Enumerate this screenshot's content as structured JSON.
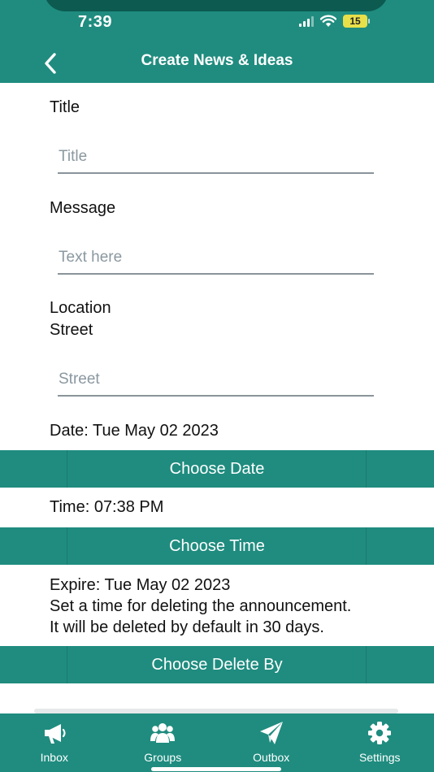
{
  "status": {
    "time": "7:39",
    "battery": "15"
  },
  "header": {
    "title": "Create News & Ideas"
  },
  "form": {
    "title_label": "Title",
    "title_placeholder": "Title",
    "message_label": "Message",
    "message_placeholder": "Text here",
    "location_label": "Location",
    "street_label": "Street",
    "street_placeholder": "Street"
  },
  "date": {
    "text": "Date: Tue May 02 2023",
    "button": "Choose Date"
  },
  "time": {
    "text": "Time: 07:38 PM",
    "button": "Choose Time"
  },
  "expire": {
    "line1": "Expire: Tue May 02 2023",
    "line2": "Set a time for deleting the announcement.",
    "line3": "It will be deleted by default in 30 days.",
    "button": "Choose Delete By"
  },
  "tabs": [
    {
      "label": "Inbox",
      "icon": "megaphone-icon"
    },
    {
      "label": "Groups",
      "icon": "group-icon"
    },
    {
      "label": "Outbox",
      "icon": "paper-plane-icon"
    },
    {
      "label": "Settings",
      "icon": "gear-icon"
    }
  ],
  "colors": {
    "primary": "#1f8c7f",
    "battery": "#e8e04a"
  }
}
